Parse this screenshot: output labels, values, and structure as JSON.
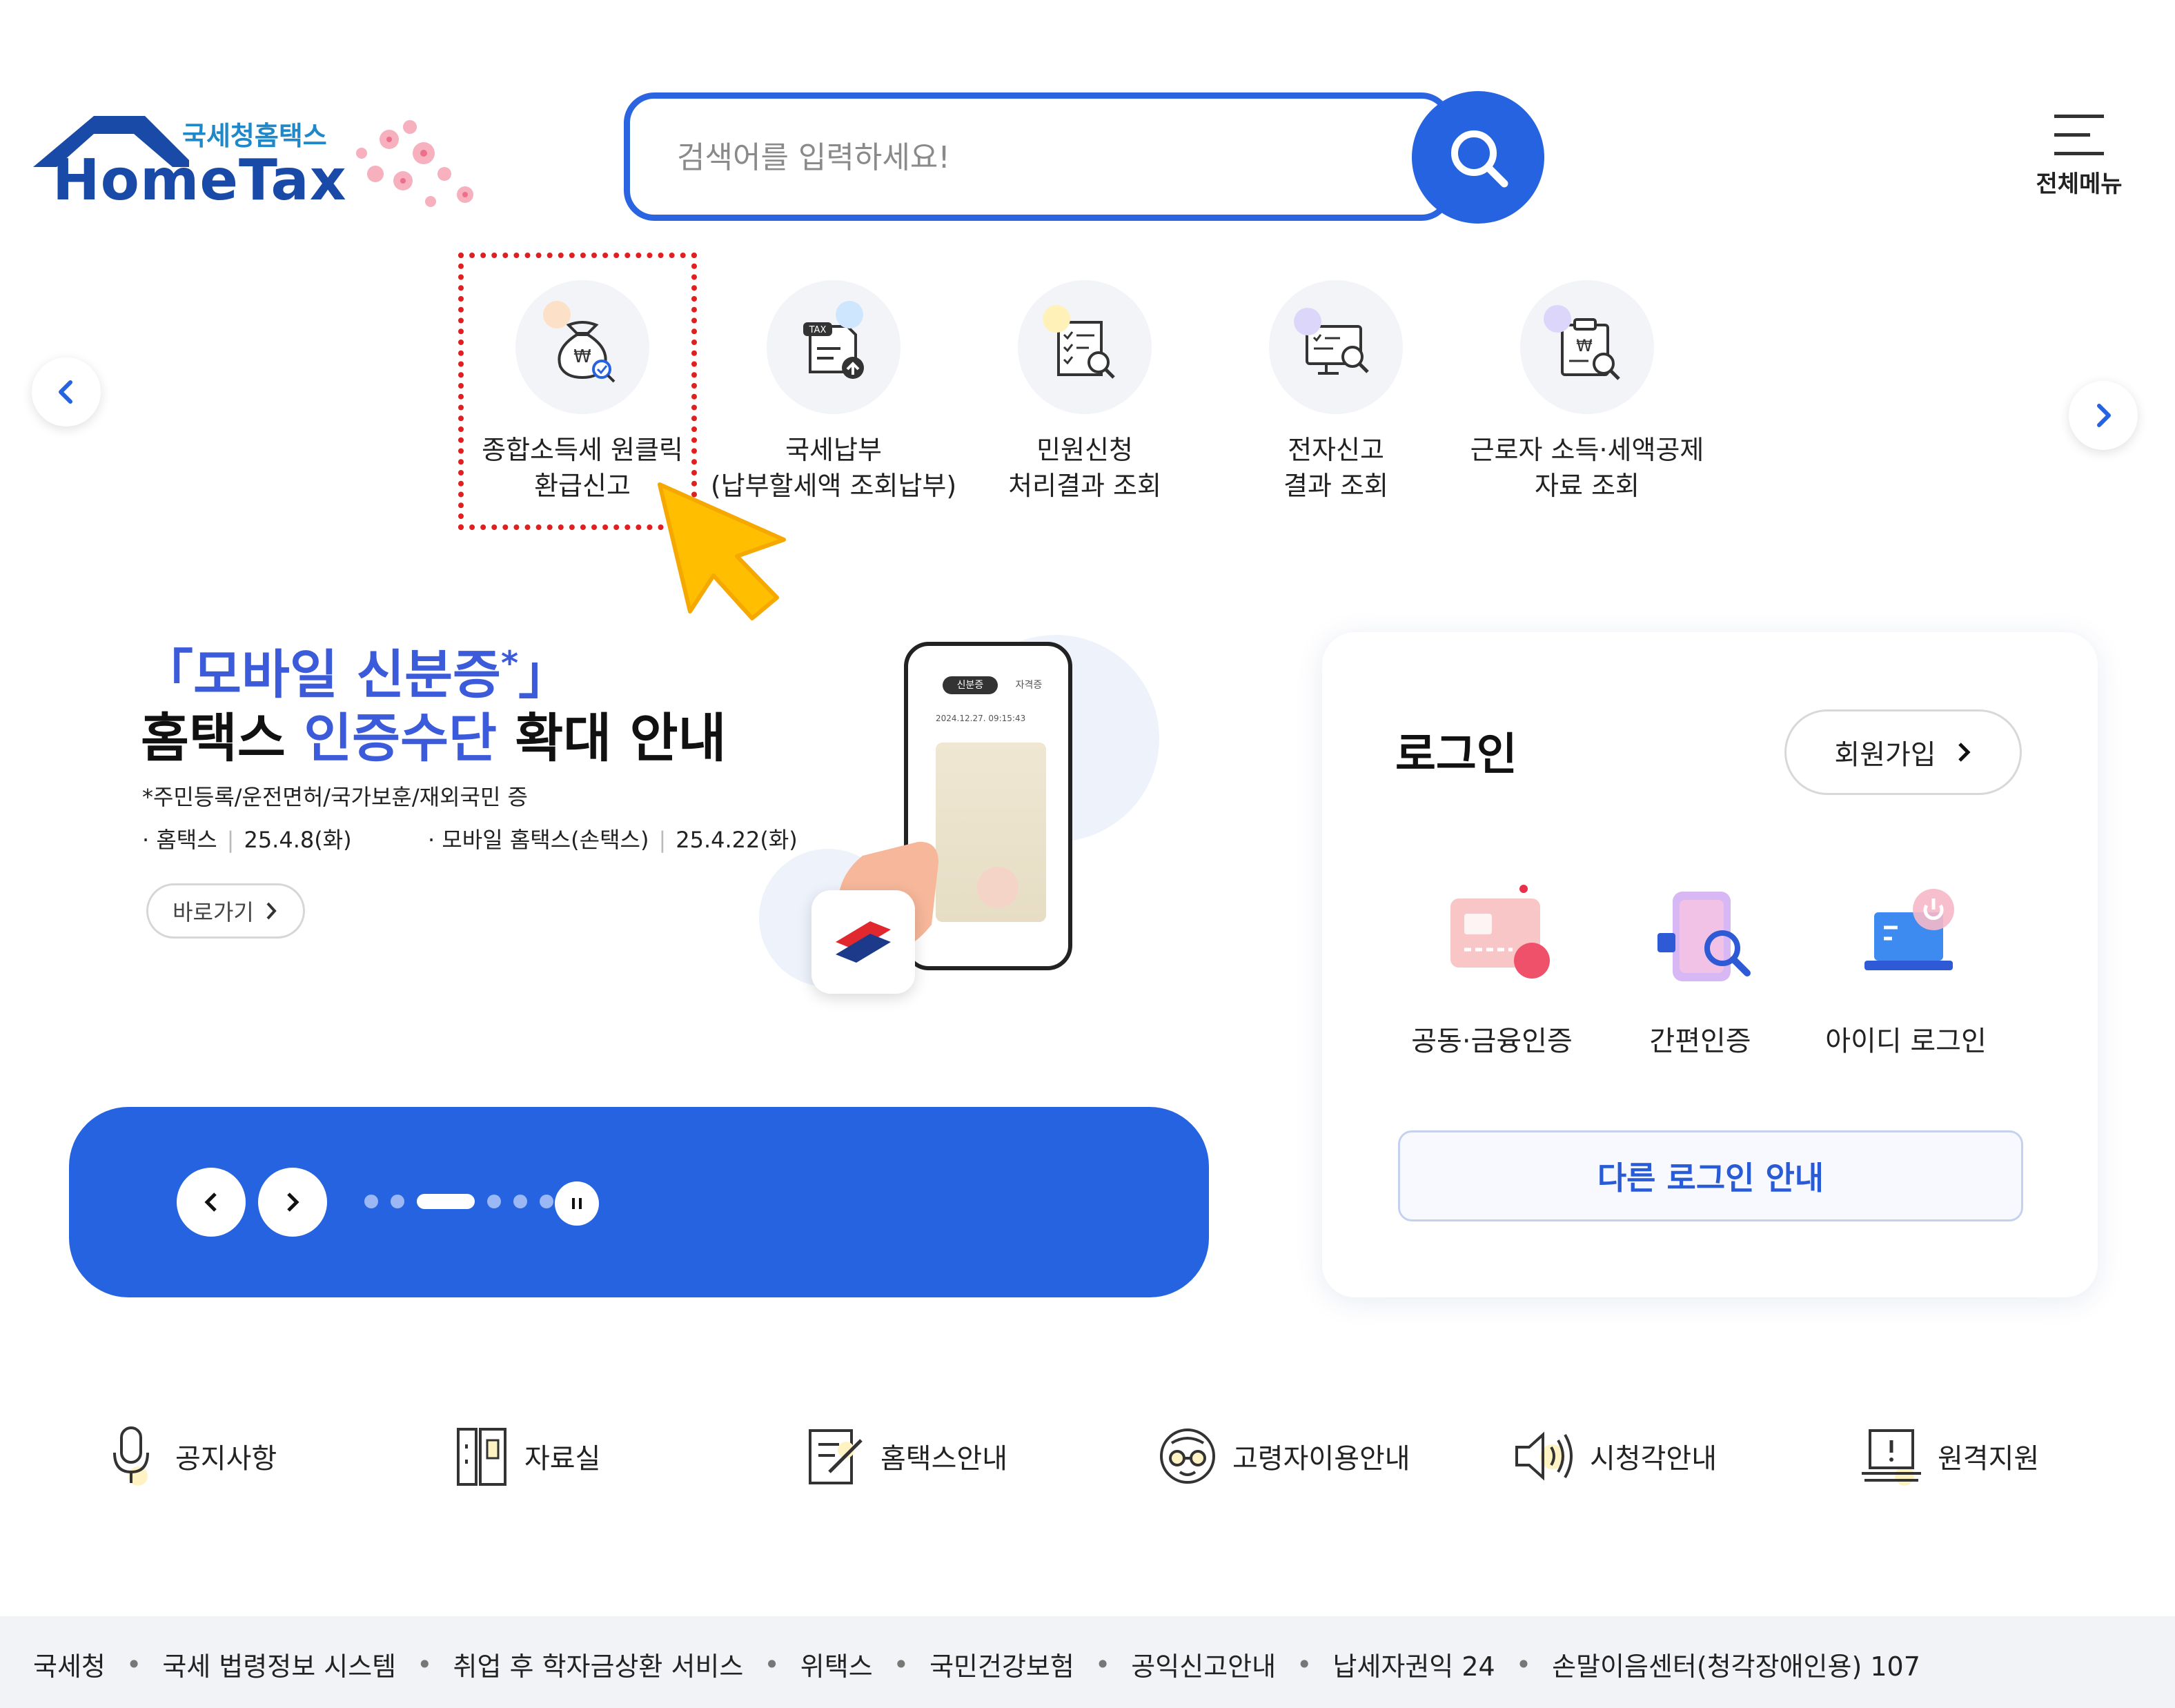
{
  "header": {
    "logo_sub": "국세청홈택스",
    "logo_main": "HomeTax",
    "search_placeholder": "검색어를 입력하세요!",
    "menu_label": "전체메뉴"
  },
  "quick_menu": [
    {
      "line1": "종합소득세 원클릭",
      "line2": "환급신고",
      "icon": "money-bag-check-icon"
    },
    {
      "line1": "국세납부",
      "line2": "(납부할세액 조회납부)",
      "icon": "tax-document-upload-icon"
    },
    {
      "line1": "민원신청",
      "line2": "처리결과 조회",
      "icon": "checklist-search-icon"
    },
    {
      "line1": "전자신고",
      "line2": "결과 조회",
      "icon": "monitor-search-icon"
    },
    {
      "line1": "근로자 소득·세액공제",
      "line2": "자료 조회",
      "icon": "clipboard-won-search-icon"
    }
  ],
  "banner": {
    "title_open": "「모바일 신분증",
    "title_star": "*",
    "title_close": "」",
    "title2_a": "홈택스 ",
    "title2_hl": "인증수단",
    "title2_b": " 확대 안내",
    "note": "*주민등록/운전면허/국가보훈/재외국민 증",
    "date1_label": "· 홈택스",
    "date1_value": "25.4.8(화)",
    "date2_label": "· 모바일 홈택스(손택스)",
    "date2_value": "25.4.22(화)",
    "go_label": "바로가기",
    "phone_tab1": "신분증",
    "phone_tab2": "자격증",
    "phone_time": "2024.12.27. 09:15:43"
  },
  "slider": {
    "total_dots": 6,
    "active_dot": 3
  },
  "login": {
    "title": "로그인",
    "join_label": "회원가입",
    "options": [
      {
        "label": "공동·금융인증",
        "icon": "certificate-card-icon"
      },
      {
        "label": "간편인증",
        "icon": "phone-search-icon"
      },
      {
        "label": "아이디 로그인",
        "icon": "laptop-power-icon"
      }
    ],
    "other_label": "다른 로그인 안내"
  },
  "bottom_links": [
    {
      "label": "공지사항",
      "icon": "microphone-icon"
    },
    {
      "label": "자료실",
      "icon": "cabinet-icon"
    },
    {
      "label": "홈택스안내",
      "icon": "edit-document-icon"
    },
    {
      "label": "고령자이용안내",
      "icon": "elderly-glasses-icon"
    },
    {
      "label": "시청각안내",
      "icon": "speaker-icon"
    },
    {
      "label": "원격지원",
      "icon": "remote-laptop-icon"
    }
  ],
  "footer_links": [
    "국세청",
    "국세 법령정보 시스템",
    "취업 후 학자금상환 서비스",
    "위택스",
    "국민건강보험",
    "공익신고안내",
    "납세자권익 24",
    "손말이음센터(청각장애인용) 107"
  ],
  "colors": {
    "primary": "#2563e0",
    "title_blue": "#3b5bdb",
    "logo_blue": "#1a4aa8",
    "highlight_red": "#e02020",
    "cursor_yellow": "#ffc107"
  }
}
